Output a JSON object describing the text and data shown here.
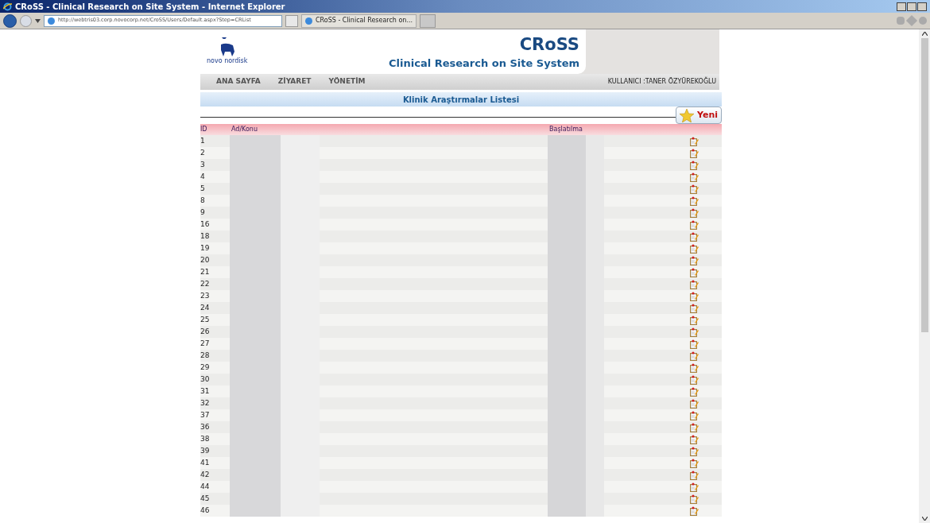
{
  "window": {
    "title": "CRoSS - Clinical Research on Site System - Internet Explorer"
  },
  "browser": {
    "address": "http://webtris03.corp.novocorp.net/CroSS/Users/Default.aspx?Step=CRList",
    "tab_title": "CRoSS - Clinical Research on..."
  },
  "header": {
    "logo_text": "novo nordisk",
    "app_name": "CRoSS",
    "app_subtitle": "Clinical Research on Site System"
  },
  "nav": {
    "items": [
      "ANA SAYFA",
      "ZİYARET",
      "YÖNETİM"
    ],
    "user": "KULLANICI :TANER ÖZYÜREKOĞLU"
  },
  "list_title": "Klinik Araştırmalar Listesi",
  "new_button": "Yeni",
  "table": {
    "columns": [
      "ID",
      "Ad/Konu",
      "Başlatılma"
    ],
    "rows": [
      {
        "number": "1"
      },
      {
        "number": "2"
      },
      {
        "number": "3"
      },
      {
        "number": "4"
      },
      {
        "number": "5"
      },
      {
        "number": "8"
      },
      {
        "number": "9"
      },
      {
        "number": "16"
      },
      {
        "number": "18"
      },
      {
        "number": "19"
      },
      {
        "number": "20"
      },
      {
        "number": "21"
      },
      {
        "number": "22"
      },
      {
        "number": "23"
      },
      {
        "number": "24"
      },
      {
        "number": "25"
      },
      {
        "number": "26"
      },
      {
        "number": "27"
      },
      {
        "number": "28"
      },
      {
        "number": "29"
      },
      {
        "number": "30"
      },
      {
        "number": "31"
      },
      {
        "number": "32"
      },
      {
        "number": "37"
      },
      {
        "number": "36"
      },
      {
        "number": "38"
      },
      {
        "number": "39"
      },
      {
        "number": "41"
      },
      {
        "number": "42"
      },
      {
        "number": "44"
      },
      {
        "number": "45"
      },
      {
        "number": "46"
      }
    ]
  }
}
